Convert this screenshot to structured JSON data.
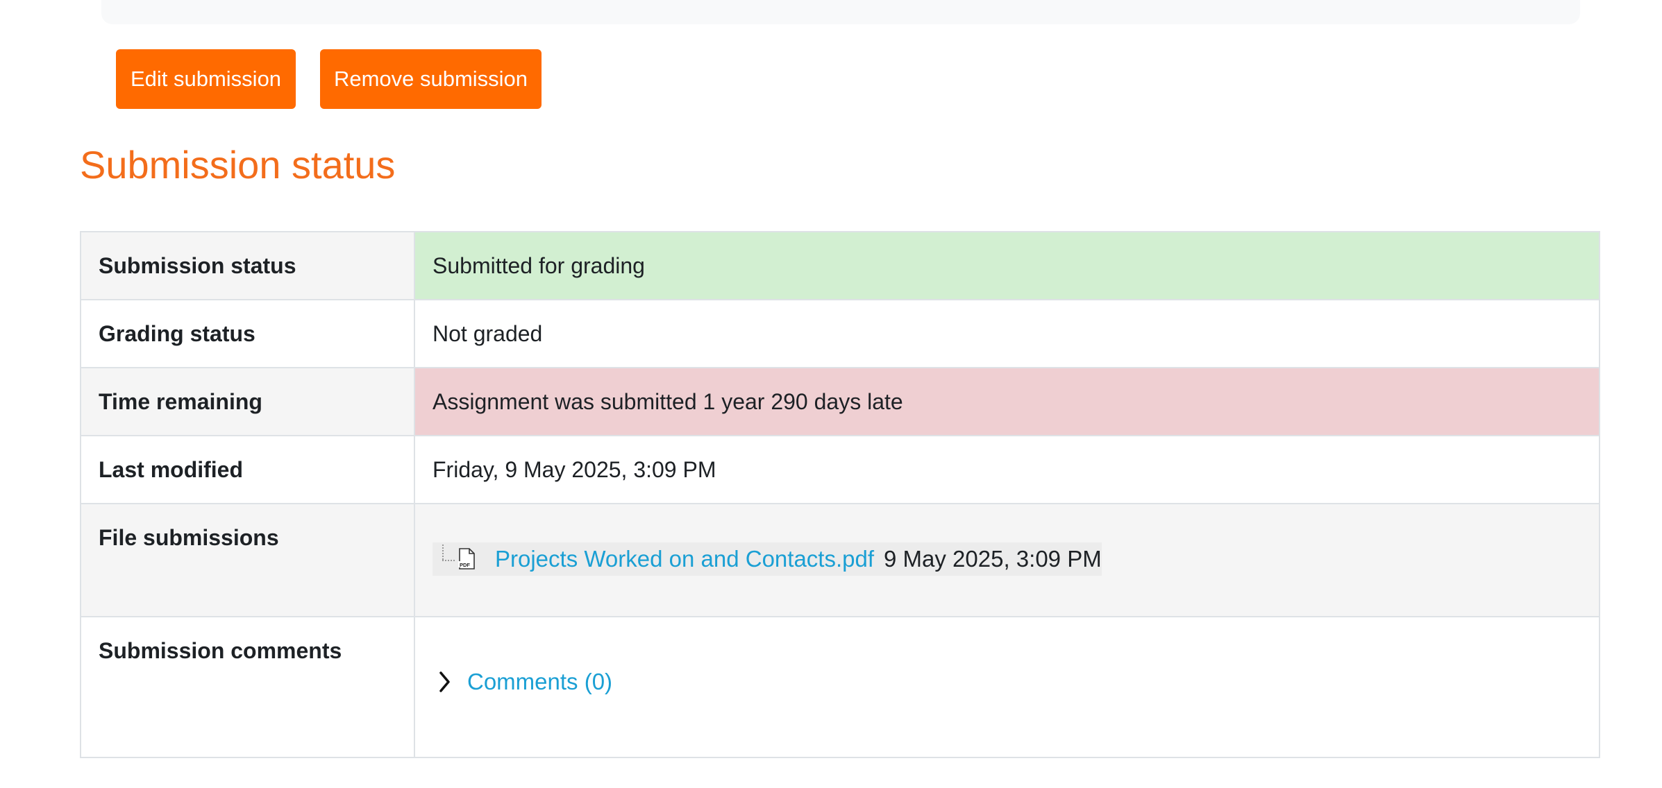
{
  "actions": {
    "edit_label": "Edit submission",
    "remove_label": "Remove submission"
  },
  "page_title": "Submission status",
  "status_rows": [
    {
      "label": "Submission status",
      "value": "Submitted for grading",
      "state": "success"
    },
    {
      "label": "Grading status",
      "value": "Not graded",
      "state": "none"
    },
    {
      "label": "Time remaining",
      "value": "Assignment was submitted 1 year 290 days late",
      "state": "danger"
    },
    {
      "label": "Last modified",
      "value": "Friday, 9 May 2025, 3:09 PM",
      "state": "none"
    }
  ],
  "files": {
    "label": "File submissions",
    "items": [
      {
        "name": "Projects Worked on and Contacts.pdf",
        "date": "9 May 2025, 3:09 PM",
        "icon": "pdf-file-icon",
        "icon_text": "PDF"
      }
    ]
  },
  "comments": {
    "label": "Submission comments",
    "link": "Comments (0)",
    "icon": "chevron-right-icon"
  },
  "colors": {
    "accent": "#ff6a00",
    "heading": "#f36d1b",
    "link": "#1a9fd4",
    "success_bg": "#d2efd1",
    "danger_bg": "#efcfd2"
  }
}
